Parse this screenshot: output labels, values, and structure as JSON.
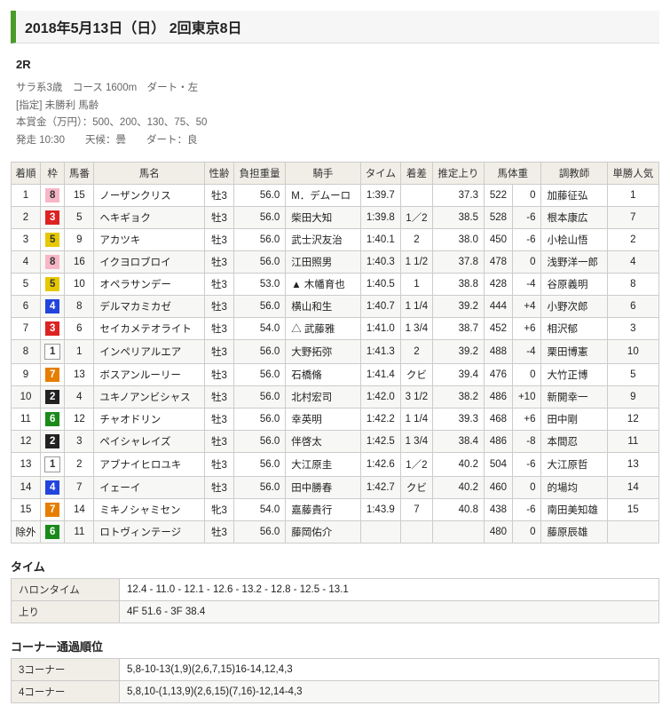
{
  "header": {
    "title": "2018年5月13日（日） 2回東京8日"
  },
  "race": {
    "number_label": "2R",
    "line1": "サラ系3歳　コース 1600m　ダート・左",
    "line2": "[指定] 未勝利 馬齢",
    "line3": "本賞金（万円）：500、200、130、75、50",
    "line4": "発走 10:30　　天候：曇　　ダート：良"
  },
  "columns": {
    "rank": "着順",
    "waku": "枠",
    "uma": "馬番",
    "name": "馬名",
    "sexage": "性齢",
    "weight": "負担重量",
    "jockey": "騎手",
    "time": "タイム",
    "margin": "着差",
    "agari": "推定上り",
    "bweight": "馬体重",
    "trainer": "調教師",
    "pop": "単勝人気"
  },
  "results": [
    {
      "rank": "1",
      "waku": 8,
      "uma": "15",
      "name": "ノーザンクリス",
      "sexage": "牡3",
      "weight": "56.0",
      "mark": "",
      "jockey": "M．デムーロ",
      "time": "1:39.7",
      "margin": "",
      "agari": "37.3",
      "bw": "522",
      "bd": "0",
      "trainer": "加藤征弘",
      "pop": "1"
    },
    {
      "rank": "2",
      "waku": 3,
      "uma": "5",
      "name": "ヘキギョク",
      "sexage": "牡3",
      "weight": "56.0",
      "mark": "",
      "jockey": "柴田大知",
      "time": "1:39.8",
      "margin": "1／2",
      "agari": "38.5",
      "bw": "528",
      "bd": "-6",
      "trainer": "根本康広",
      "pop": "7"
    },
    {
      "rank": "3",
      "waku": 5,
      "uma": "9",
      "name": "アカツキ",
      "sexage": "牡3",
      "weight": "56.0",
      "mark": "",
      "jockey": "武士沢友治",
      "time": "1:40.1",
      "margin": "2",
      "agari": "38.0",
      "bw": "450",
      "bd": "-6",
      "trainer": "小桧山悟",
      "pop": "2"
    },
    {
      "rank": "4",
      "waku": 8,
      "uma": "16",
      "name": "イクヨロブロイ",
      "sexage": "牡3",
      "weight": "56.0",
      "mark": "",
      "jockey": "江田照男",
      "time": "1:40.3",
      "margin": "1 1/2",
      "agari": "37.8",
      "bw": "478",
      "bd": "0",
      "trainer": "浅野洋一郎",
      "pop": "4"
    },
    {
      "rank": "5",
      "waku": 5,
      "uma": "10",
      "name": "オペラサンデー",
      "sexage": "牡3",
      "weight": "53.0",
      "mark": "▲",
      "jockey": "木幡育也",
      "time": "1:40.5",
      "margin": "1",
      "agari": "38.8",
      "bw": "428",
      "bd": "-4",
      "trainer": "谷原義明",
      "pop": "8"
    },
    {
      "rank": "6",
      "waku": 4,
      "uma": "8",
      "name": "デルマカミカゼ",
      "sexage": "牡3",
      "weight": "56.0",
      "mark": "",
      "jockey": "横山和生",
      "time": "1:40.7",
      "margin": "1 1/4",
      "agari": "39.2",
      "bw": "444",
      "bd": "+4",
      "trainer": "小野次郎",
      "pop": "6"
    },
    {
      "rank": "7",
      "waku": 3,
      "uma": "6",
      "name": "セイカメテオライト",
      "sexage": "牡3",
      "weight": "54.0",
      "mark": "△",
      "jockey": "武藤雅",
      "time": "1:41.0",
      "margin": "1 3/4",
      "agari": "38.7",
      "bw": "452",
      "bd": "+6",
      "trainer": "相沢郁",
      "pop": "3"
    },
    {
      "rank": "8",
      "waku": 1,
      "uma": "1",
      "name": "インペリアルエア",
      "sexage": "牡3",
      "weight": "56.0",
      "mark": "",
      "jockey": "大野拓弥",
      "time": "1:41.3",
      "margin": "2",
      "agari": "39.2",
      "bw": "488",
      "bd": "-4",
      "trainer": "栗田博憲",
      "pop": "10"
    },
    {
      "rank": "9",
      "waku": 7,
      "uma": "13",
      "name": "ボスアンルーリー",
      "sexage": "牡3",
      "weight": "56.0",
      "mark": "",
      "jockey": "石橋脩",
      "time": "1:41.4",
      "margin": "クビ",
      "agari": "39.4",
      "bw": "476",
      "bd": "0",
      "trainer": "大竹正博",
      "pop": "5"
    },
    {
      "rank": "10",
      "waku": 2,
      "uma": "4",
      "name": "ユキノアンビシャス",
      "sexage": "牡3",
      "weight": "56.0",
      "mark": "",
      "jockey": "北村宏司",
      "time": "1:42.0",
      "margin": "3 1/2",
      "agari": "38.2",
      "bw": "486",
      "bd": "+10",
      "trainer": "新開幸一",
      "pop": "9"
    },
    {
      "rank": "11",
      "waku": 6,
      "uma": "12",
      "name": "チャオドリン",
      "sexage": "牡3",
      "weight": "56.0",
      "mark": "",
      "jockey": "幸英明",
      "time": "1:42.2",
      "margin": "1 1/4",
      "agari": "39.3",
      "bw": "468",
      "bd": "+6",
      "trainer": "田中剛",
      "pop": "12"
    },
    {
      "rank": "12",
      "waku": 2,
      "uma": "3",
      "name": "ペイシャレイズ",
      "sexage": "牡3",
      "weight": "56.0",
      "mark": "",
      "jockey": "伴啓太",
      "time": "1:42.5",
      "margin": "1 3/4",
      "agari": "38.4",
      "bw": "486",
      "bd": "-8",
      "trainer": "本間忍",
      "pop": "11"
    },
    {
      "rank": "13",
      "waku": 1,
      "uma": "2",
      "name": "アブナイヒロユキ",
      "sexage": "牡3",
      "weight": "56.0",
      "mark": "",
      "jockey": "大江原圭",
      "time": "1:42.6",
      "margin": "1／2",
      "agari": "40.2",
      "bw": "504",
      "bd": "-6",
      "trainer": "大江原哲",
      "pop": "13"
    },
    {
      "rank": "14",
      "waku": 4,
      "uma": "7",
      "name": "イェーイ",
      "sexage": "牡3",
      "weight": "56.0",
      "mark": "",
      "jockey": "田中勝春",
      "time": "1:42.7",
      "margin": "クビ",
      "agari": "40.2",
      "bw": "460",
      "bd": "0",
      "trainer": "的場均",
      "pop": "14"
    },
    {
      "rank": "15",
      "waku": 7,
      "uma": "14",
      "name": "ミキノシャミセン",
      "sexage": "牝3",
      "weight": "54.0",
      "mark": "",
      "jockey": "嘉藤貴行",
      "time": "1:43.9",
      "margin": "7",
      "agari": "40.8",
      "bw": "438",
      "bd": "-6",
      "trainer": "南田美知雄",
      "pop": "15"
    },
    {
      "rank": "除外",
      "waku": 6,
      "uma": "11",
      "name": "ロトヴィンテージ",
      "sexage": "牡3",
      "weight": "56.0",
      "mark": "",
      "jockey": "藤岡佑介",
      "time": "",
      "margin": "",
      "agari": "",
      "bw": "480",
      "bd": "0",
      "trainer": "藤原辰雄",
      "pop": ""
    }
  ],
  "time_section": {
    "title": "タイム",
    "rows": [
      {
        "k": "ハロンタイム",
        "v": "12.4 - 11.0 - 12.1 - 12.6 - 13.2 - 12.8 - 12.5 - 13.1"
      },
      {
        "k": "上り",
        "v": "4F 51.6 - 3F 38.4"
      }
    ]
  },
  "corner_section": {
    "title": "コーナー通過順位",
    "rows": [
      {
        "k": "3コーナー",
        "v": "5,8-10-13(1,9)(2,6,7,15)16-14,12,4,3"
      },
      {
        "k": "4コーナー",
        "v": "5,8,10-(1,13,9)(2,6,15)(7,16)-12,14-4,3"
      }
    ]
  }
}
